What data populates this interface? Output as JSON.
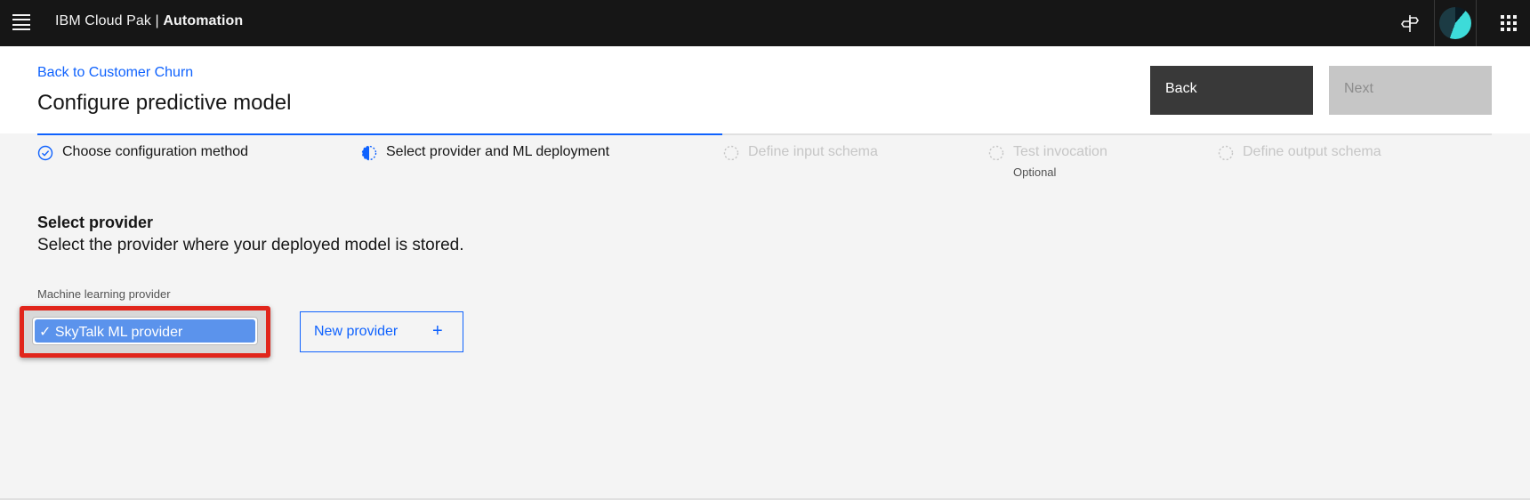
{
  "header": {
    "brand_prefix": "IBM Cloud Pak",
    "brand_separator": " | ",
    "brand_product": "Automation",
    "icons": [
      "menu-icon",
      "guide-icon",
      "avatar",
      "app-switcher-icon"
    ]
  },
  "page": {
    "back_link": "Back to Customer Churn",
    "title": "Configure predictive model",
    "back_button": "Back",
    "next_button": "Next"
  },
  "progress": {
    "steps": [
      {
        "label": "Choose configuration method",
        "state": "complete"
      },
      {
        "label": "Select provider and ML deployment",
        "state": "current"
      },
      {
        "label": "Define input schema",
        "state": "incomplete"
      },
      {
        "label": "Test invocation",
        "sublabel": "Optional",
        "state": "incomplete"
      },
      {
        "label": "Define output schema",
        "state": "incomplete"
      }
    ]
  },
  "content": {
    "section_title": "Select provider",
    "section_desc": "Select the provider where your deployed model is stored.",
    "field_label": "Machine learning provider",
    "selected_option": "✓ SkyTalk ML provider",
    "new_provider_button": "New provider",
    "new_provider_icon": "+"
  },
  "colors": {
    "accent": "#0f62fe",
    "header_bg": "#161616",
    "highlight": "#e1261c",
    "selected_option_bg": "#5b93ec"
  }
}
